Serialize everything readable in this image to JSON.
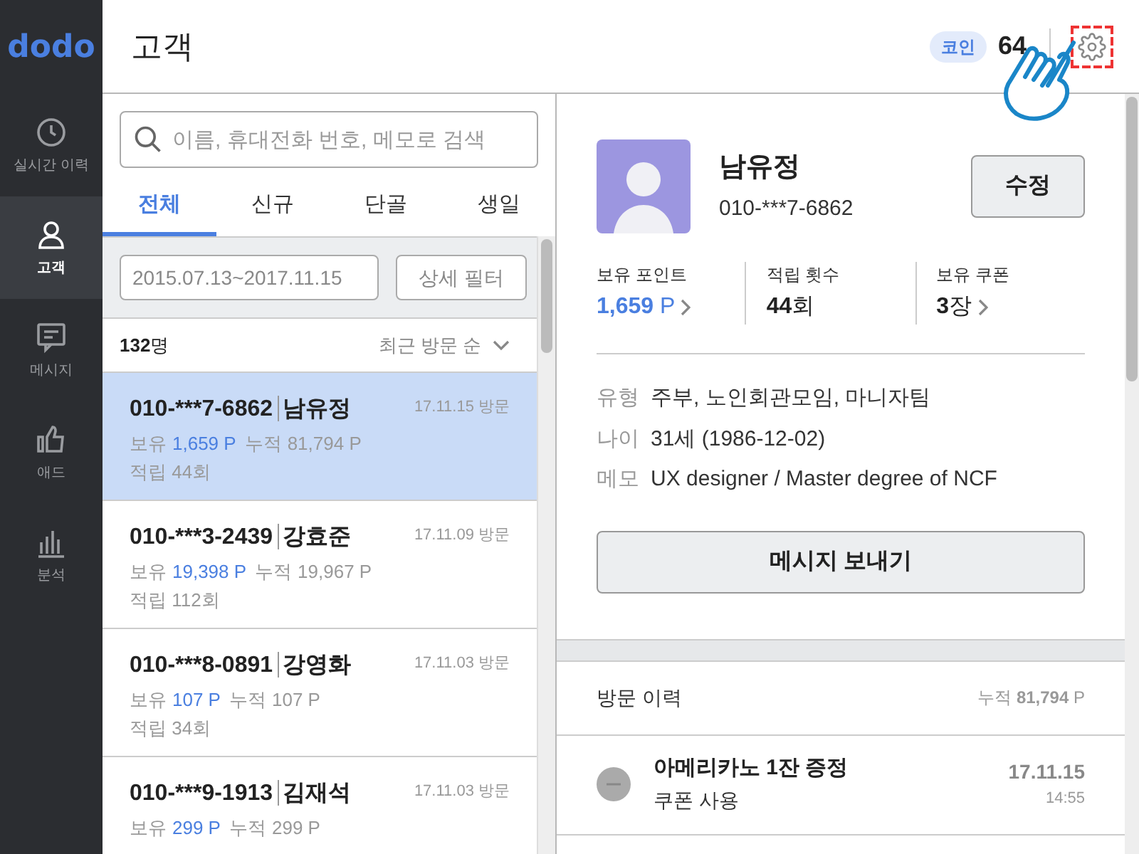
{
  "app": {
    "logo": "dodo"
  },
  "sidebar": {
    "items": [
      {
        "label": "실시간 이력",
        "kind": "clock",
        "selected": false
      },
      {
        "label": "고객",
        "kind": "person",
        "selected": true
      },
      {
        "label": "메시지",
        "kind": "message",
        "selected": false
      },
      {
        "label": "애드",
        "kind": "thumb",
        "selected": false
      },
      {
        "label": "분석",
        "kind": "chart",
        "selected": false
      }
    ]
  },
  "header": {
    "title": "고객",
    "coin_label": "코인",
    "coin_count": "64",
    "settings_highlighted": true
  },
  "search": {
    "placeholder": "이름, 휴대전화 번호, 메모로 검색"
  },
  "tabs": [
    {
      "label": "전체",
      "selected": true
    },
    {
      "label": "신규",
      "selected": false
    },
    {
      "label": "단골",
      "selected": false
    },
    {
      "label": "생일",
      "selected": false
    }
  ],
  "filter": {
    "date_range": "2015.07.13~2017.11.15",
    "button": "상세 필터"
  },
  "list_header": {
    "count": "**132**명",
    "sort": "최근 방문 순"
  },
  "customers": [
    {
      "phone": "010-***7-6862",
      "name": "남유정",
      "date": "17.11.15 방문",
      "held_label": "보유",
      "held": "1,659 P",
      "total_label": "누적",
      "total": "81,794 P",
      "visits": "적립 44회",
      "selected": true
    },
    {
      "phone": "010-***3-2439",
      "name": "강효준",
      "date": "17.11.09 방문",
      "held_label": "보유",
      "held": "19,398 P",
      "total_label": "누적",
      "total": "19,967 P",
      "visits": "적립 112회",
      "selected": false
    },
    {
      "phone": "010-***8-0891",
      "name": "강영화",
      "date": "17.11.03 방문",
      "held_label": "보유",
      "held": "107 P",
      "total_label": "누적",
      "total": "107 P",
      "visits": "적립 34회",
      "selected": false
    },
    {
      "phone": "010-***9-1913",
      "name": "김재석",
      "date": "17.11.03 방문",
      "held_label": "보유",
      "held": "299 P",
      "total_label": "누적",
      "total": "299 P",
      "selected": false
    }
  ],
  "detail": {
    "name": "남유정",
    "phone": "010-***7-6862",
    "edit_button": "수정",
    "stats": [
      {
        "label": "보유 포인트",
        "value": "**1,659** P",
        "link": true,
        "accent": true
      },
      {
        "label": "적립 횟수",
        "value": "**44**회",
        "link": false,
        "accent": false
      },
      {
        "label": "보유 쿠폰",
        "value": "**3**장",
        "link": true,
        "accent": false
      }
    ],
    "info": [
      {
        "label": "유형",
        "value": "주부, 노인회관모임, 마니자팀"
      },
      {
        "label": "나이",
        "value": "31세 (1986-12-02)"
      },
      {
        "label": "메모",
        "value": "UX designer / Master degree of NCF"
      }
    ],
    "message_button": "메시지 보내기"
  },
  "visit_history": {
    "title": "방문 이력",
    "total": "누적 **81,794** P",
    "entries": [
      {
        "title": "아메리카노 1잔 증정",
        "subtitle": "쿠폰 사용",
        "date": "17.11.15",
        "time": "14:55",
        "kind": "minus"
      }
    ]
  }
}
